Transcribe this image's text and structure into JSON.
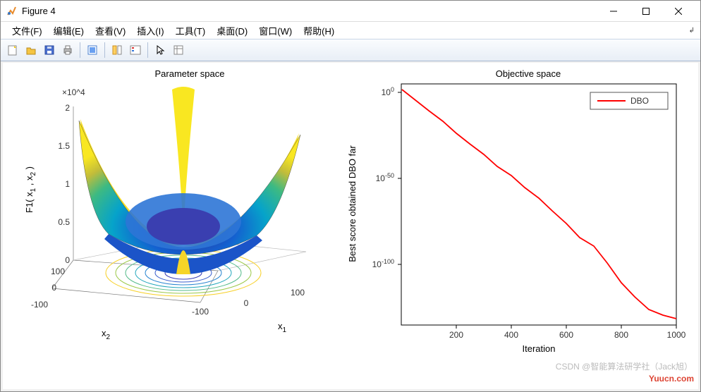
{
  "window": {
    "title": "Figure 4",
    "minimize_tip": "Minimize",
    "maximize_tip": "Maximize",
    "close_tip": "Close"
  },
  "menu": {
    "file": "文件(F)",
    "edit": "编辑(E)",
    "view": "查看(V)",
    "insert": "插入(I)",
    "tools": "工具(T)",
    "desktop": "桌面(D)",
    "window": "窗口(W)",
    "help": "帮助(H)"
  },
  "toolbar": {
    "new": "New Figure",
    "open": "Open",
    "save": "Save",
    "print": "Print",
    "link": "Link/Data",
    "tile": "Tile",
    "legend": "Legend",
    "pointer": "Pointer",
    "insert": "Insert"
  },
  "left": {
    "title": "Parameter space",
    "zlabel": "F1( x_1 , x_2 )",
    "xlabel": "x_1",
    "ylabel": "x_2",
    "x_ticks": [
      -100,
      0,
      100
    ],
    "y_ticks": [
      -100,
      0,
      100
    ],
    "z_ticks": [
      0,
      0.5,
      1,
      1.5,
      2
    ],
    "z_multiplier_text": "×10^4",
    "z_multiplier_value": 10000,
    "z_range_actual": [
      0,
      20000
    ],
    "surface_function": "F1(x1,x2) = x1^2 + x2^2"
  },
  "right": {
    "title": "Objective space",
    "xlabel": "Iteration",
    "ylabel": "Best score obtained DBO far",
    "legend": "DBO",
    "x_ticks": [
      200,
      400,
      600,
      800,
      1000
    ],
    "y_ticks_exp": [
      -100,
      -50,
      0
    ],
    "x_range": [
      0,
      1000
    ],
    "y_range_log10": [
      -135,
      5
    ]
  },
  "watermark": {
    "line1": "CSDN @智能算法研学社（Jack旭）",
    "line2": "Yuucn.com"
  },
  "chart_data": [
    {
      "type": "surface3d",
      "title": "Parameter space",
      "xlabel": "x_1",
      "ylabel": "x_2",
      "zlabel": "F1( x_1 , x_2 )",
      "x_range": [
        -100,
        100
      ],
      "y_range": [
        -100,
        100
      ],
      "z_range": [
        0,
        20000
      ],
      "z_tick_values": [
        0,
        5000,
        10000,
        15000,
        20000
      ],
      "z_tick_labels_on_axis": [
        "0",
        "0.5",
        "1",
        "1.5",
        "2"
      ],
      "z_axis_multiplier": 10000,
      "function": "z = x1^2 + x2^2",
      "has_contour_projection": true,
      "colormap": "parula"
    },
    {
      "type": "line",
      "title": "Objective space",
      "xlabel": "Iteration",
      "ylabel": "Best score obtained DBO far",
      "y_scale": "log",
      "x": [
        1,
        50,
        100,
        150,
        200,
        250,
        300,
        350,
        400,
        450,
        500,
        550,
        600,
        650,
        700,
        750,
        800,
        850,
        900,
        950,
        1000
      ],
      "y": [
        3.0,
        1e-06,
        1e-12,
        1e-18,
        1e-25,
        1e-31,
        1e-37,
        1e-44,
        1e-50,
        1e-57,
        1e-63,
        1e-70,
        1e-77,
        1e-84,
        1e-93,
        1e-100,
        1e-108,
        1e-117,
        1e-126,
        1e-131,
        1e-133
      ],
      "series": [
        {
          "name": "DBO",
          "color": "#ff0000"
        }
      ],
      "x_ticks": [
        200,
        400,
        600,
        800,
        1000
      ],
      "y_ticks": [
        1e-100,
        1e-50,
        1
      ]
    }
  ]
}
